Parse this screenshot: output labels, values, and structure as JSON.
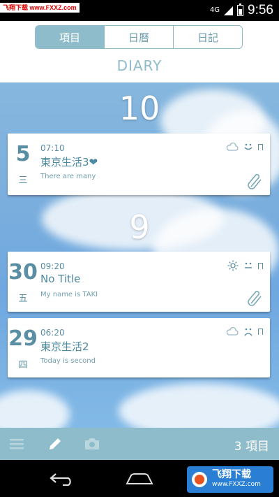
{
  "status_bar": {
    "watermark": "飞翔下载 www.FXXZ.com",
    "network": "4G",
    "time": "9:56"
  },
  "header": {
    "tabs": [
      {
        "label": "項目",
        "active": true
      },
      {
        "label": "日曆",
        "active": false
      },
      {
        "label": "日記",
        "active": false
      }
    ],
    "title": "DIARY"
  },
  "months": [
    {
      "label": "10",
      "entries": [
        {
          "day": "5",
          "weekday": "三",
          "time": "07:10",
          "title": "東京生活3❤",
          "snippet": "There are many",
          "weather_icon": "cloud-icon",
          "mood_icon": "smile-icon",
          "has_attachment": true
        }
      ]
    },
    {
      "label": "9",
      "entries": [
        {
          "day": "30",
          "weekday": "五",
          "time": "09:20",
          "title": "No Title",
          "snippet": "My name is TAKI",
          "weather_icon": "sun-icon",
          "mood_icon": "neutral-face-icon",
          "has_attachment": true
        },
        {
          "day": "29",
          "weekday": "四",
          "time": "06:20",
          "title": "東京生活2",
          "snippet": "Today is second",
          "weather_icon": "cloud-icon",
          "mood_icon": "sad-face-icon",
          "has_attachment": false
        }
      ]
    }
  ],
  "bottom_bar": {
    "count": "3 項目"
  },
  "watermark_bottom": {
    "main": "飞翔下载",
    "sub": "www.FXXZ.com"
  },
  "colors": {
    "accent": "#8fbcca",
    "text_accent": "#5a8ea3"
  }
}
